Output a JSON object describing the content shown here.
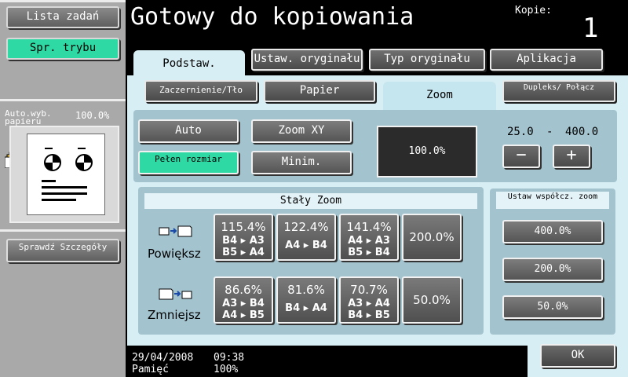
{
  "sidebar": {
    "job_list_label": "Lista zadań",
    "check_mode_label": "Spr. trybu",
    "auto_paper_label": "Auto.wyb. papieru",
    "auto_paper_value": "100.0%",
    "check_details_label": "Sprawdź Szczegóły"
  },
  "header": {
    "title": "Gotowy do kopiowania",
    "copies_label": "Kopie:",
    "copies_value": "1"
  },
  "tabs": {
    "basic": "Podstaw.",
    "original_settings": "Ustaw. oryginału",
    "original_type": "Typ oryginału",
    "application": "Aplikacja"
  },
  "subtabs": {
    "background": "Zaczernienie/Tło",
    "paper": "Papier",
    "zoom": "Zoom",
    "duplex": "Dupleks/ Połącz"
  },
  "zoom_controls": {
    "auto": "Auto",
    "zoom_xy": "Zoom XY",
    "full_size": "Pełen rozmiar",
    "minimal": "Minim.",
    "current": "100.0%",
    "range_min": "25.0",
    "range_dash": "-",
    "range_max": "400.0",
    "minus": "−",
    "plus": "+"
  },
  "fixed_zoom": {
    "title": "Stały Zoom",
    "enlarge_label": "Powiększ",
    "reduce_label": "Zmniejsz",
    "enlarge": [
      {
        "pct": "115.4%",
        "line1": "B4 ▸ A3",
        "line2": "B5 ▸ A4"
      },
      {
        "pct": "122.4%",
        "line1": "A4 ▸ B4",
        "line2": ""
      },
      {
        "pct": "141.4%",
        "line1": "A4 ▸ A3",
        "line2": "B5 ▸ B4"
      },
      {
        "pct": "200.0%",
        "line1": "",
        "line2": ""
      }
    ],
    "reduce": [
      {
        "pct": "86.6%",
        "line1": "A3 ▸ B4",
        "line2": "A4 ▸ B5"
      },
      {
        "pct": "81.6%",
        "line1": "B4 ▸ A4",
        "line2": ""
      },
      {
        "pct": "70.7%",
        "line1": "A3 ▸ A4",
        "line2": "B4 ▸ B5"
      },
      {
        "pct": "50.0%",
        "line1": "",
        "line2": ""
      }
    ]
  },
  "custom_zoom": {
    "title": "Ustaw współcz. zoom",
    "values": [
      "400.0%",
      "200.0%",
      "50.0%"
    ]
  },
  "footer": {
    "date": "29/04/2008",
    "time": "09:38",
    "memory_label": "Pamięć",
    "memory_value": "100%",
    "ok_label": "OK"
  },
  "colors": {
    "accent_green": "#2fd9a4",
    "panel_bg": "#d8eef5",
    "area_bg": "#a3c4cf"
  }
}
